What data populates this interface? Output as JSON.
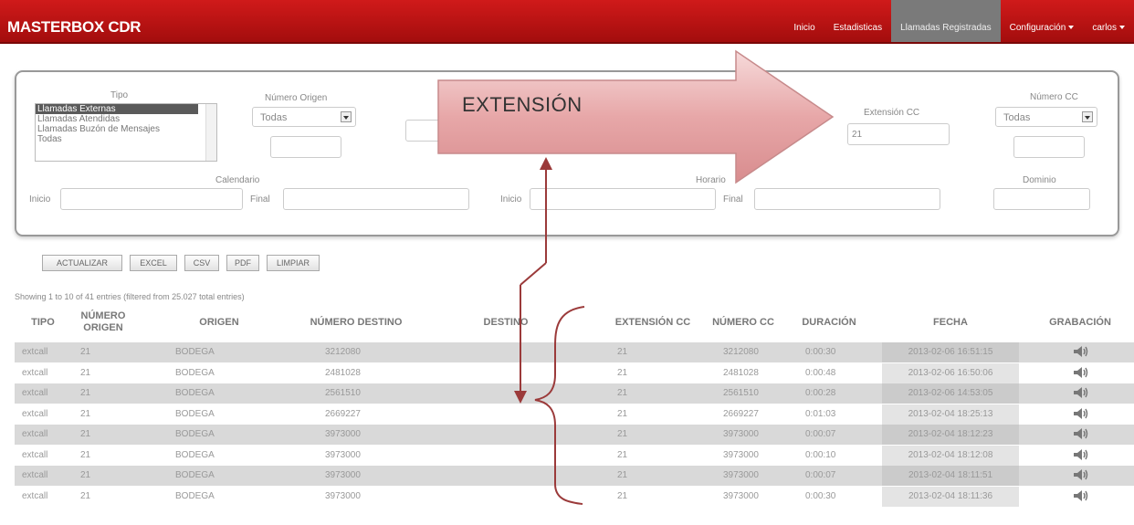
{
  "brand": "MASTERBOX CDR",
  "nav": {
    "inicio": "Inicio",
    "estadisticas": "Estadisticas",
    "llamadas": "Llamadas Registradas",
    "configuracion": "Configuración",
    "user": "carlos"
  },
  "filters": {
    "tipo_label": "Tipo",
    "tipo_options": [
      "Llamadas Externas",
      "Llamadas Atendidas",
      "Llamadas Buzón de Mensajes",
      "Todas"
    ],
    "numero_origen_label": "Número Origen",
    "numero_origen_value": "Todas",
    "extension_cc_label": "Extensión CC",
    "extension_cc_value": "21",
    "numero_cc_label": "Número CC",
    "numero_cc_value": "Todas",
    "calendario_label": "Calendario",
    "horario_label": "Horario",
    "dominio_label": "Dominio",
    "inicio_label": "Inicio",
    "final_label": "Final"
  },
  "buttons": {
    "actualizar": "ACTUALIZAR",
    "excel": "EXCEL",
    "csv": "CSV",
    "pdf": "PDF",
    "limpiar": "LIMPIAR"
  },
  "info": "Showing 1 to 10 of 41 entries (filtered from 25.027 total entries)",
  "table": {
    "headers": {
      "tipo": "TIPO",
      "numero_origen": "NÚMERO ORIGEN",
      "origen": "ORIGEN",
      "numero_destino": "NÚMERO DESTINO",
      "destino": "DESTINO",
      "extension_cc": "EXTENSIÓN CC",
      "numero_cc": "NÚMERO CC",
      "duracion": "DURACIÓN",
      "fecha": "FECHA",
      "grabacion": "GRABACIÓN"
    },
    "rows": [
      {
        "tipo": "extcall",
        "num_origen": "21",
        "origen": "BODEGA",
        "num_destino": "3212080",
        "ext_cc": "21",
        "num_cc": "3212080",
        "duracion": "0:00:30",
        "fecha": "2013-02-06 16:51:15"
      },
      {
        "tipo": "extcall",
        "num_origen": "21",
        "origen": "BODEGA",
        "num_destino": "2481028",
        "ext_cc": "21",
        "num_cc": "2481028",
        "duracion": "0:00:48",
        "fecha": "2013-02-06 16:50:06"
      },
      {
        "tipo": "extcall",
        "num_origen": "21",
        "origen": "BODEGA",
        "num_destino": "2561510",
        "ext_cc": "21",
        "num_cc": "2561510",
        "duracion": "0:00:28",
        "fecha": "2013-02-06 14:53:05"
      },
      {
        "tipo": "extcall",
        "num_origen": "21",
        "origen": "BODEGA",
        "num_destino": "2669227",
        "ext_cc": "21",
        "num_cc": "2669227",
        "duracion": "0:01:03",
        "fecha": "2013-02-04 18:25:13"
      },
      {
        "tipo": "extcall",
        "num_origen": "21",
        "origen": "BODEGA",
        "num_destino": "3973000",
        "ext_cc": "21",
        "num_cc": "3973000",
        "duracion": "0:00:07",
        "fecha": "2013-02-04 18:12:23"
      },
      {
        "tipo": "extcall",
        "num_origen": "21",
        "origen": "BODEGA",
        "num_destino": "3973000",
        "ext_cc": "21",
        "num_cc": "3973000",
        "duracion": "0:00:10",
        "fecha": "2013-02-04 18:12:08"
      },
      {
        "tipo": "extcall",
        "num_origen": "21",
        "origen": "BODEGA",
        "num_destino": "3973000",
        "ext_cc": "21",
        "num_cc": "3973000",
        "duracion": "0:00:07",
        "fecha": "2013-02-04 18:11:51"
      },
      {
        "tipo": "extcall",
        "num_origen": "21",
        "origen": "BODEGA",
        "num_destino": "3973000",
        "ext_cc": "21",
        "num_cc": "3973000",
        "duracion": "0:00:30",
        "fecha": "2013-02-04 18:11:36"
      }
    ]
  },
  "annotation": {
    "label": "EXTENSIÓN",
    "arrow_color": "#e7a7a8",
    "line_color": "#9b3a3a"
  },
  "icons": {
    "recording": "speaker-icon"
  }
}
